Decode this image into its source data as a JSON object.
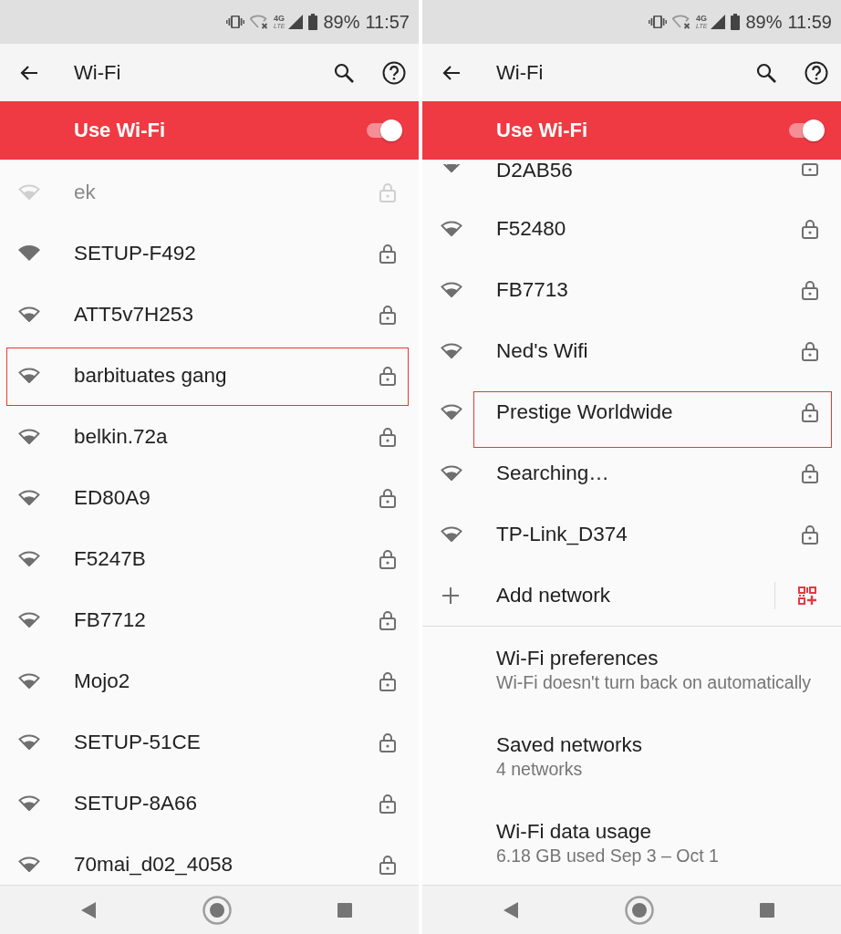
{
  "screens": [
    {
      "status_bar": {
        "network_type": "4G",
        "network_sub": "LTE",
        "battery": "89%",
        "time": "11:57"
      },
      "app_bar": {
        "title": "Wi-Fi"
      },
      "master_switch": {
        "label": "Use Wi-Fi",
        "on": true
      },
      "networks": [
        {
          "kind": "faded",
          "name": "ek",
          "full_signal": false,
          "locked": true,
          "highlighted": false
        },
        {
          "kind": "normal",
          "name": "SETUP-F492",
          "full_signal": true,
          "locked": true,
          "highlighted": false
        },
        {
          "kind": "normal",
          "name": "ATT5v7H253",
          "full_signal": false,
          "locked": true,
          "highlighted": false
        },
        {
          "kind": "normal",
          "name": "barbituates gang",
          "full_signal": false,
          "locked": true,
          "highlighted": true
        },
        {
          "kind": "normal",
          "name": "belkin.72a",
          "full_signal": false,
          "locked": true,
          "highlighted": false
        },
        {
          "kind": "normal",
          "name": "ED80A9",
          "full_signal": false,
          "locked": true,
          "highlighted": false
        },
        {
          "kind": "normal",
          "name": "F5247B",
          "full_signal": false,
          "locked": true,
          "highlighted": false
        },
        {
          "kind": "normal",
          "name": "FB7712",
          "full_signal": false,
          "locked": true,
          "highlighted": false
        },
        {
          "kind": "normal",
          "name": "Mojo2",
          "full_signal": false,
          "locked": true,
          "highlighted": false
        },
        {
          "kind": "normal",
          "name": "SETUP-51CE",
          "full_signal": false,
          "locked": true,
          "highlighted": false
        },
        {
          "kind": "normal",
          "name": "SETUP-8A66",
          "full_signal": false,
          "locked": true,
          "highlighted": false
        },
        {
          "kind": "normal",
          "name": "70mai_d02_4058",
          "full_signal": false,
          "locked": true,
          "highlighted": false
        }
      ]
    },
    {
      "status_bar": {
        "network_type": "4G",
        "network_sub": "LTE",
        "battery": "89%",
        "time": "11:59"
      },
      "app_bar": {
        "title": "Wi-Fi"
      },
      "master_switch": {
        "label": "Use Wi-Fi",
        "on": true
      },
      "networks": [
        {
          "kind": "clipped",
          "name": "D2AB56",
          "full_signal": false,
          "locked": true,
          "highlighted": false
        },
        {
          "kind": "normal",
          "name": "F52480",
          "full_signal": false,
          "locked": true,
          "highlighted": false
        },
        {
          "kind": "normal",
          "name": "FB7713",
          "full_signal": false,
          "locked": true,
          "highlighted": false
        },
        {
          "kind": "normal",
          "name": "Ned's Wifi",
          "full_signal": false,
          "locked": true,
          "highlighted": false
        },
        {
          "kind": "normal",
          "name": "Prestige Worldwide",
          "full_signal": false,
          "locked": true,
          "highlighted": true
        },
        {
          "kind": "normal",
          "name": "Searching…",
          "full_signal": false,
          "locked": true,
          "highlighted": false
        },
        {
          "kind": "normal",
          "name": "TP-Link_D374",
          "full_signal": false,
          "locked": true,
          "highlighted": false
        }
      ],
      "add_network": {
        "label": "Add network"
      },
      "preferences": [
        {
          "title": "Wi-Fi preferences",
          "summary": "Wi-Fi doesn't turn back on automatically"
        },
        {
          "title": "Saved networks",
          "summary": "4 networks"
        },
        {
          "title": "Wi-Fi data usage",
          "summary": "6.18 GB used Sep 3 – Oct 1"
        }
      ]
    }
  ]
}
